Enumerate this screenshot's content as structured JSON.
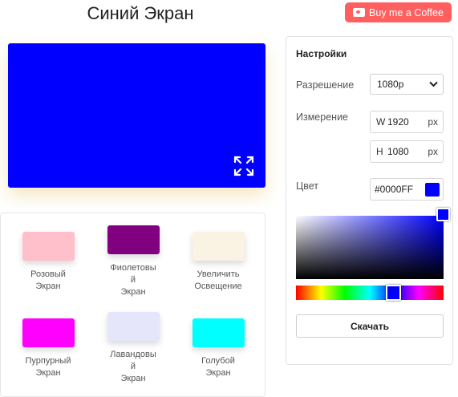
{
  "header": {
    "title": "Синий Экран",
    "coffee_label": "Buy me a Coffee"
  },
  "preview": {
    "color": "#0000FF",
    "icon": "fullscreen-icon"
  },
  "presets": [
    {
      "label_line1": "Розовый",
      "label_line2": "Экран",
      "color": "#FFC0CB"
    },
    {
      "label_line1": "Фиолетовы",
      "label_line2": "й",
      "label_line3": "Экран",
      "color": "#800080"
    },
    {
      "label_line1": "Увеличить",
      "label_line2": "Освещение",
      "color": "#FAF3E3"
    },
    {
      "label_line1": "Пурпурный",
      "label_line2": "Экран",
      "color": "#FF00FF"
    },
    {
      "label_line1": "Лавандовы",
      "label_line2": "й",
      "label_line3": "Экран",
      "color": "#E6E6FA"
    },
    {
      "label_line1": "Голубой",
      "label_line2": "Экран",
      "color": "#00FFFF"
    }
  ],
  "settings": {
    "title": "Настройки",
    "resolution_label": "Разрешение",
    "resolution_value": "1080p",
    "dimension_label": "Измерение",
    "width_prefix": "W",
    "width_value": "1920",
    "height_prefix": "H",
    "height_value": "1080",
    "unit": "px",
    "color_label": "Цвет",
    "color_value": "#0000FF",
    "download_label": "Скачать"
  },
  "colors": {
    "accent": "#FF5F5F",
    "selected": "#0000FF"
  }
}
